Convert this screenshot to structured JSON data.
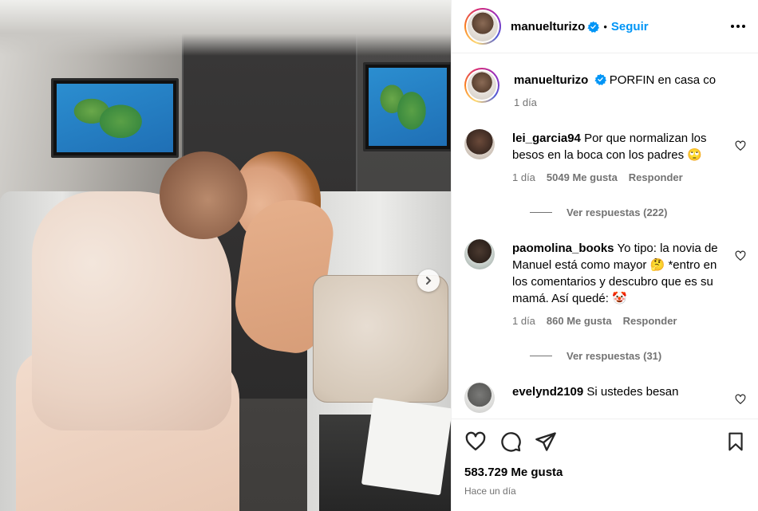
{
  "post": {
    "username": "manuelturizo",
    "follow_label": "Seguir",
    "caption": "PORFIN en casa co",
    "caption_time": "1 día",
    "likes": "583.729 Me gusta",
    "posted_ago": "Hace un día"
  },
  "comments": [
    {
      "username": "lei_garcia94",
      "text": "Por que normalizan los besos en la boca con los padres",
      "emoji": "🙄",
      "time": "1 día",
      "likes": "5049 Me gusta",
      "reply_label": "Responder",
      "view_replies": "Ver respuestas (222)"
    },
    {
      "username": "paomolina_books",
      "text_1": "Yo tipo: la novia de Manuel está como mayor",
      "emoji_1": "🤔",
      "text_2": "*entro en los comentarios y descubro que es su mamá. Así quedé:",
      "emoji_2": "🤡",
      "time": "1 día",
      "likes": "860 Me gusta",
      "reply_label": "Responder",
      "view_replies": "Ver respuestas (31)"
    },
    {
      "username": "evelynd2109",
      "text": "Si ustedes besan"
    }
  ],
  "icons": {
    "like": "heart-icon",
    "comment": "comment-icon",
    "share": "share-icon",
    "save": "bookmark-icon",
    "more": "more-options-icon",
    "next": "chevron-right-icon",
    "verified": "verified-badge-icon"
  },
  "colors": {
    "accent": "#0095f6",
    "muted": "#737373",
    "border": "#efefef"
  }
}
